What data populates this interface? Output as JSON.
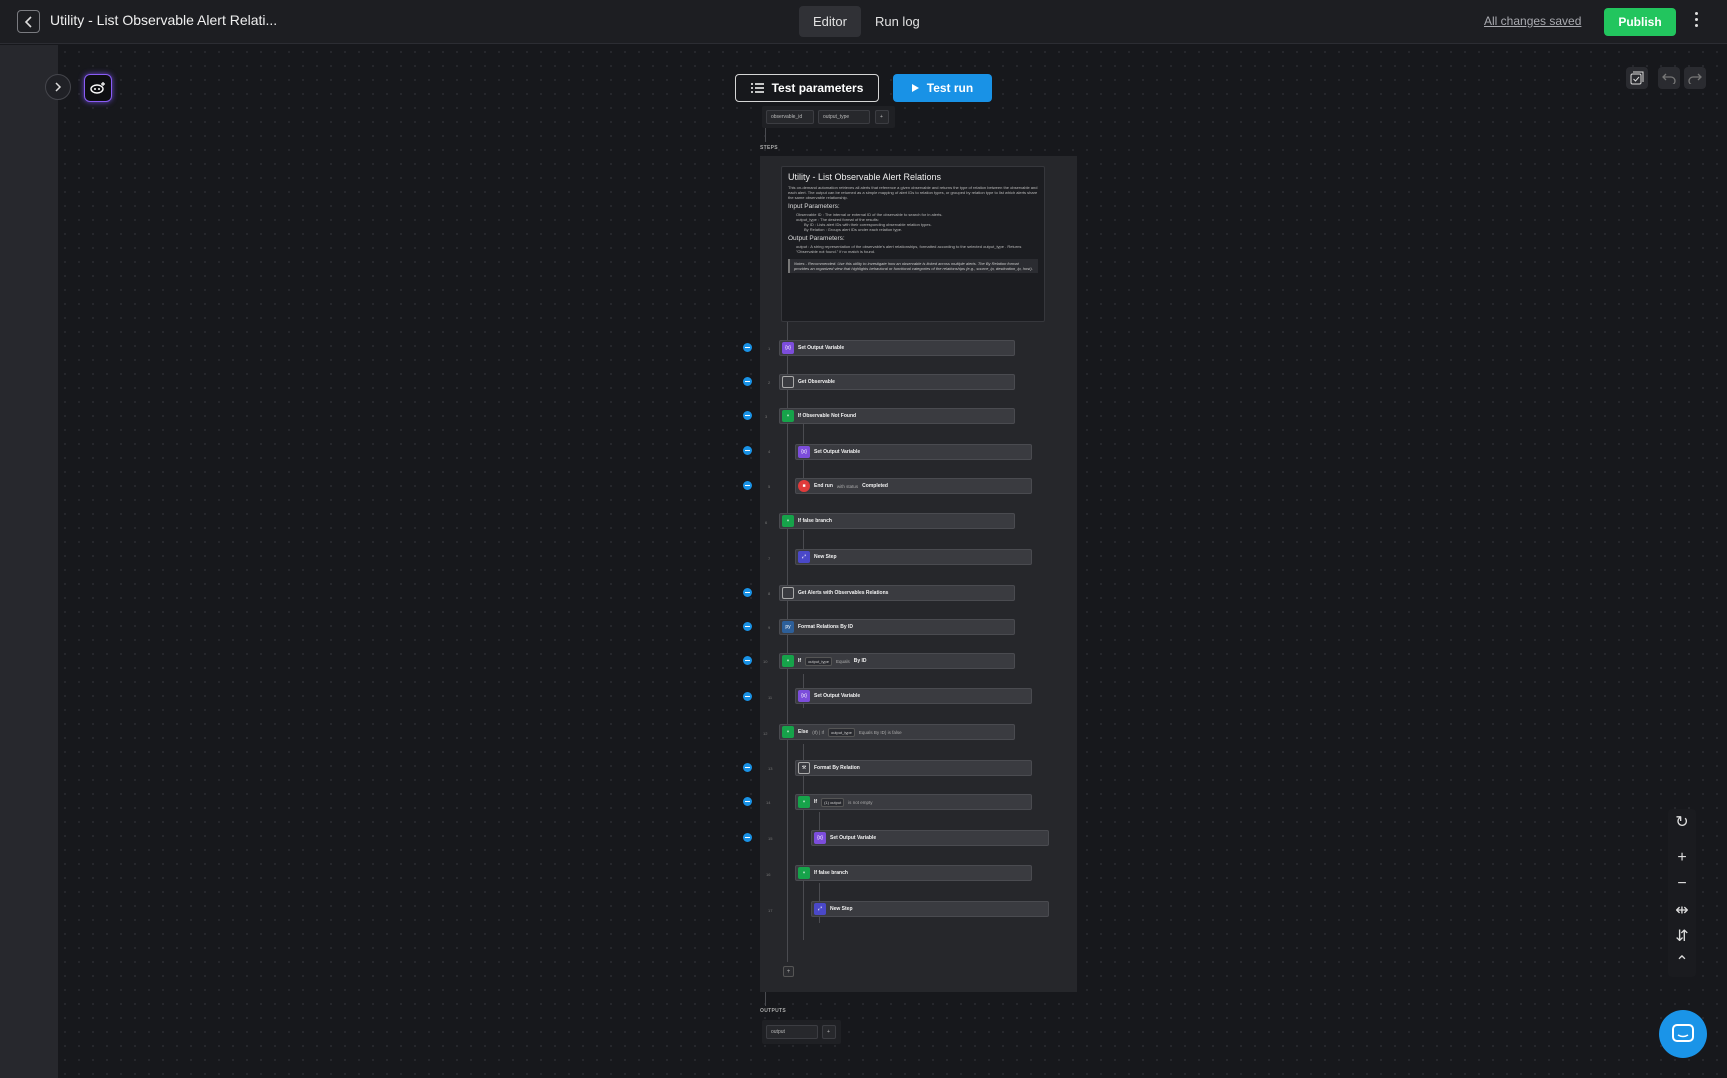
{
  "header": {
    "title": "Utility - List Observable Alert Relati...",
    "tabs": [
      {
        "label": "Editor",
        "active": true
      },
      {
        "label": "Run log",
        "active": false
      }
    ],
    "save_status": "All changes saved",
    "publish_label": "Publish"
  },
  "toolbar": {
    "test_parameters_label": "Test parameters",
    "test_run_label": "Test run"
  },
  "inputs": {
    "chips": [
      "observable_id",
      "output_type",
      "+"
    ]
  },
  "steps_label": "STEPS",
  "outputs_label": "OUTPUTS",
  "outputs": {
    "chips": [
      "output",
      "+"
    ]
  },
  "description": {
    "title": "Utility - List Observable Alert Relations",
    "summary": "This on-demand automation retrieves all alerts that reference a given observable and returns the type of relation between the observable and each alert. The output can be returned as a simple mapping of alert IDs to relation types, or grouped by relation type to list which alerts share the same observable relationship.",
    "input_heading": "Input Parameters:",
    "input_items": [
      "Observable ID : The internal or external ID of the observable to search for in alerts.",
      "output_type : The desired format of the results:",
      "By ID : Lists alert IDs with their corresponding observable relation types.",
      "By Relation : Groups alert IDs under each relation type."
    ],
    "output_heading": "Output Parameters:",
    "output_items": [
      "output : A string representation of the observable's alert relationships, formatted according to the selected output_type . Returns \"Observable not found.\" if no match is found."
    ],
    "note": "Notes - Recommended: Use this utility to investigate how an observable is linked across multiple alerts. The By Relation format provides an organized view that highlights behavioral or functional categories of the relationships (e.g., source_ip, destination_ip, host)."
  },
  "steps": [
    {
      "num": "1",
      "label": "Set Output Variable",
      "icon": "variable-icon"
    },
    {
      "num": "2",
      "label": "Get Observable",
      "icon": "document-icon"
    },
    {
      "num": "3",
      "label": "If Observable Not Found",
      "icon": "branch-icon"
    },
    {
      "num": "4",
      "label": "Set Output Variable",
      "icon": "variable-icon"
    },
    {
      "num": "5",
      "label": "End run",
      "muted": "with status",
      "extra": "Completed",
      "icon": "stop-icon"
    },
    {
      "num": "6",
      "label": "If false branch",
      "icon": "branch-else-icon"
    },
    {
      "num": "7",
      "label": "New Step",
      "icon": "new-step-icon"
    },
    {
      "num": "8",
      "label": "Get Alerts with Observables Relations",
      "icon": "document-icon"
    },
    {
      "num": "9",
      "label": "Format Relations By ID",
      "icon": "python-icon"
    },
    {
      "num": "10",
      "label": "If",
      "chip": "output_type",
      "muted": "Equals",
      "extra": "By ID",
      "icon": "branch-icon"
    },
    {
      "num": "11",
      "label": "Set Output Variable",
      "icon": "variable-icon"
    },
    {
      "num": "12",
      "label": "Else",
      "muted": "(If) | If",
      "chip": "output_type",
      "extra": "Equals By ID) is false",
      "icon": "branch-else-icon"
    },
    {
      "num": "13",
      "label": "Format By Relation",
      "icon": "wrench-icon"
    },
    {
      "num": "14",
      "label": "If",
      "chip": "(1) output",
      "muted": "is not empty",
      "icon": "branch-icon"
    },
    {
      "num": "15",
      "label": "Set Output Variable",
      "icon": "variable-icon"
    },
    {
      "num": "16",
      "label": "If false branch",
      "icon": "branch-else-icon"
    },
    {
      "num": "17",
      "label": "New Step",
      "icon": "new-step-icon"
    }
  ],
  "colors": {
    "accent": "#1992e6",
    "publish": "#22c55e",
    "variable": "#7c4ddb",
    "branch": "#16a34a",
    "stop": "#e03b3b"
  }
}
